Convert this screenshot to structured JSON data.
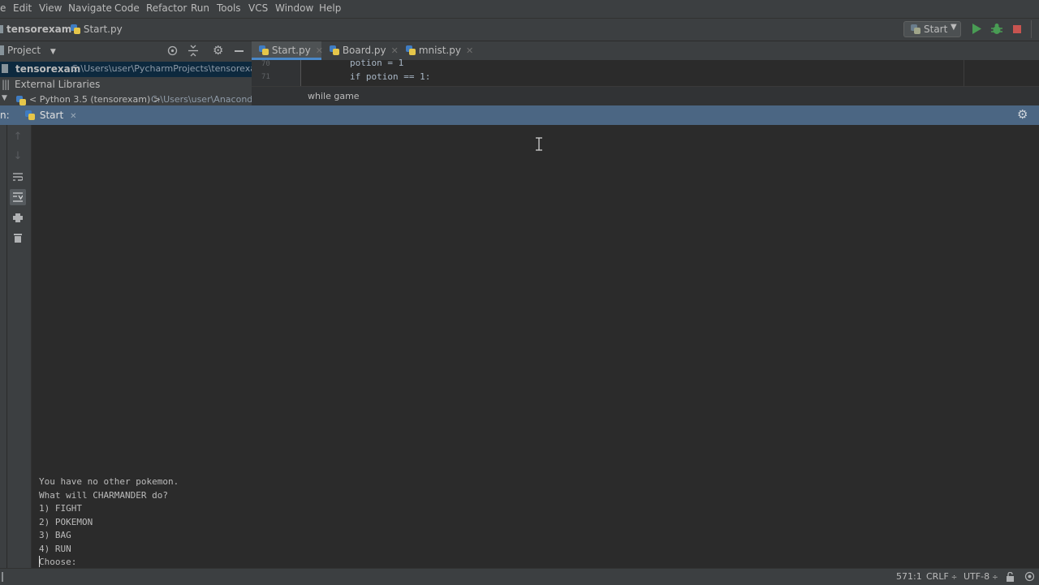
{
  "menu": [
    "e",
    "Edit",
    "View",
    "Navigate",
    "Code",
    "Refactor",
    "Run",
    "Tools",
    "VCS",
    "Window",
    "Help"
  ],
  "navbar": {
    "project": "tensorexam",
    "file": "Start.py"
  },
  "run_config": {
    "label": "Start"
  },
  "project_panel": {
    "label": "Project"
  },
  "editor_tabs": [
    {
      "label": "Start.py"
    },
    {
      "label": "Board.py"
    },
    {
      "label": "mnist.py"
    }
  ],
  "tree": {
    "root_name": "tensorexam",
    "root_path": "C:\\Users\\user\\PycharmProjects\\tensorexam",
    "external_libraries": "External Libraries",
    "sdk": "< Python 3.5 (tensorexam) >",
    "sdk_path": "C:\\Users\\user\\Anaconda"
  },
  "code": {
    "line70_num": "70",
    "line70": "potion = 1",
    "line71_num": "71",
    "line71": "if potion == 1:"
  },
  "code_breadcrumb": "while game",
  "run_panel": {
    "prefix": "n:",
    "tab": "Start"
  },
  "console_lines": [
    "You have no other pokemon.",
    "What will CHARMANDER do?",
    "1) FIGHT",
    "2) POKEMON",
    "3) BAG",
    "4) RUN",
    "Choose:"
  ],
  "status": {
    "position": "571:1",
    "line_sep": "CRLF",
    "encoding": "UTF-8"
  },
  "colors": {
    "accent": "#4a88c7",
    "run_header": "#4b6683",
    "run_green": "#499c54",
    "stop_red": "#c75450"
  }
}
